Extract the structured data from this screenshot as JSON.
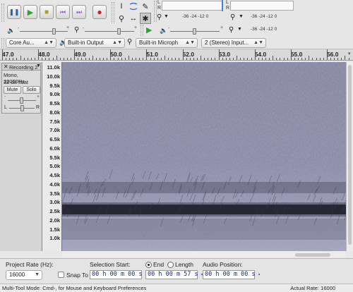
{
  "transport": {
    "buttons": [
      {
        "name": "pause",
        "glyph": "❚❚",
        "color": "#2a5fc2"
      },
      {
        "name": "play",
        "glyph": "▶",
        "color": "#2ea12e"
      },
      {
        "name": "stop",
        "glyph": "■",
        "color": "#b79a2b"
      },
      {
        "name": "skip-start",
        "glyph": "⏮",
        "color": "#8e5ac8"
      },
      {
        "name": "skip-end",
        "glyph": "⏭",
        "color": "#8e5ac8"
      },
      {
        "name": "record",
        "glyph": "●",
        "color": "#d52020"
      }
    ]
  },
  "meters": {
    "rec_ticks": "-36   -24   -12    0",
    "play_ticks": "-36   -24   -12    0",
    "play_ticks_2": "-36   -24   -12    0",
    "L": "L",
    "R": "R"
  },
  "devices": {
    "host": "Core Au...",
    "output": "Built-in Output",
    "input": "Built-in Microph",
    "channels": "2 (Stereo) Input..."
  },
  "ruler": {
    "labels": [
      "47.0",
      "48.0",
      "49.0",
      "50.0",
      "51.0",
      "52.0",
      "53.0",
      "54.0",
      "55.0",
      "56.0"
    ]
  },
  "track": {
    "name": "Recording 2",
    "rate": "Mono, 22050Hz",
    "format": "32-bit float",
    "mute": "Mute",
    "solo": "Solo",
    "pan_left": "L",
    "pan_right": "R"
  },
  "freq_scale": [
    "11.0k",
    "10.0k",
    "9.5k",
    "9.0k",
    "8.5k",
    "8.0k",
    "7.5k",
    "7.0k",
    "6.5k",
    "6.0k",
    "5.5k",
    "5.0k",
    "4.5k",
    "4.0k",
    "3.5k",
    "3.0k",
    "2.5k",
    "2.0k",
    "1.5k",
    "1.0k"
  ],
  "selection": {
    "project_rate_label": "Project Rate (Hz):",
    "project_rate": "16000",
    "snap_label": "Snap To",
    "selection_start_label": "Selection Start:",
    "end_label": "End",
    "length_label": "Length",
    "start_value": "00 h 00 m 00 s",
    "end_value": "00 h 00 m 57 s",
    "audio_position_label": "Audio Position:",
    "audio_position": "00 h 00 m 00 s"
  },
  "status": {
    "left": "Multi-Tool Mode: Cmd-, for Mouse and Keyboard Preferences",
    "right": "Actual Rate: 16000"
  }
}
